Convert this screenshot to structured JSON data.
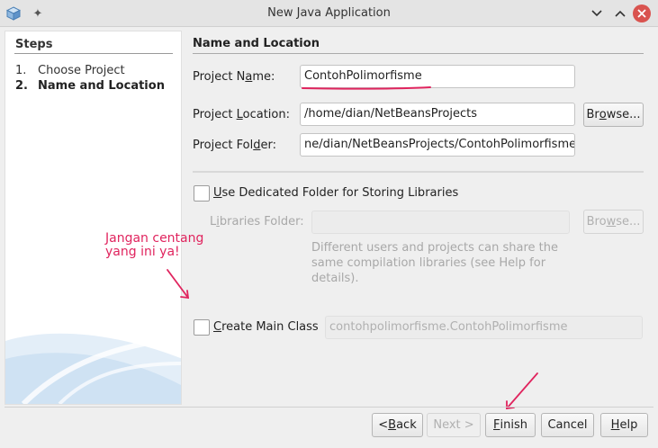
{
  "window": {
    "title": "New Java Application"
  },
  "steps": {
    "heading": "Steps",
    "items": [
      {
        "num": "1.",
        "label": "Choose Project"
      },
      {
        "num": "2.",
        "label": "Name and Location"
      }
    ]
  },
  "main": {
    "section_title": "Name and Location",
    "project_name": {
      "label_pre": "Project N",
      "label_u": "a",
      "label_post": "me:",
      "value": "ContohPolimorfisme"
    },
    "project_location": {
      "label_pre": "Project ",
      "label_u": "L",
      "label_post": "ocation:",
      "value": "/home/dian/NetBeansProjects",
      "browse_pre": "Br",
      "browse_u": "o",
      "browse_post": "wse..."
    },
    "project_folder": {
      "label_pre": "Project Fol",
      "label_u": "d",
      "label_post": "er:",
      "value": "ne/dian/NetBeansProjects/ContohPolimorfisme"
    },
    "dedicated_folder": {
      "label_pre": "",
      "label_u": "U",
      "label_post": "se Dedicated Folder for Storing Libraries",
      "checked": false
    },
    "libraries_folder": {
      "label_pre": "L",
      "label_u": "i",
      "label_post": "braries Folder:",
      "value": "",
      "browse_pre": "Bro",
      "browse_u": "w",
      "browse_post": "se..."
    },
    "help_text": "Different users and projects can share the same compilation libraries (see Help for details).",
    "main_class": {
      "label_pre": "",
      "label_u": "C",
      "label_post": "reate Main Class",
      "value": "contohpolimorfisme.ContohPolimorfisme",
      "checked": false
    }
  },
  "annotation": {
    "line1": "Jangan centang",
    "line2": "yang ini ya!",
    "color": "#e0245e"
  },
  "buttons": {
    "back": {
      "pre": "< ",
      "u": "B",
      "post": "ack"
    },
    "next": {
      "label": "Next >"
    },
    "finish": {
      "pre": "",
      "u": "F",
      "post": "inish"
    },
    "cancel": {
      "label": "Cancel"
    },
    "help": {
      "pre": "",
      "u": "H",
      "post": "elp"
    }
  }
}
